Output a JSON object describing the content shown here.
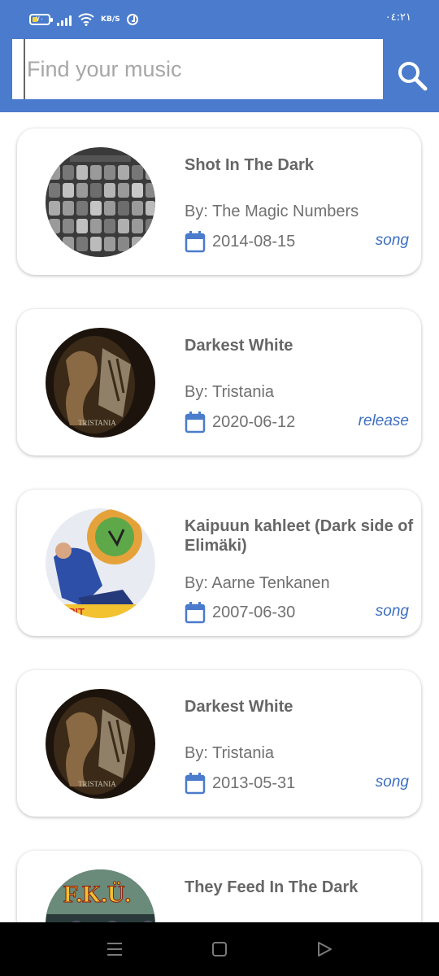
{
  "status_bar": {
    "battery_label": "٧٠",
    "net_speed": "KB/S",
    "time": "٠٤:٢١"
  },
  "search": {
    "placeholder": "Find your music",
    "value": ""
  },
  "results": [
    {
      "title": "Shot In The Dark",
      "artist": "By: The Magic Numbers",
      "date": "2014-08-15",
      "type": "song",
      "art": "magic-numbers-faces"
    },
    {
      "title": "Darkest White",
      "artist": "By: Tristania",
      "date": "2020-06-12",
      "type": "release",
      "art": "tristania"
    },
    {
      "title": "Kaipuun kahleet (Dark side of Elimäki)",
      "artist": "By: Aarne Tenkanen",
      "date": "2007-06-30",
      "type": "song",
      "art": "tenkanen"
    },
    {
      "title": "Darkest White",
      "artist": "By: Tristania",
      "date": "2013-05-31",
      "type": "song",
      "art": "tristania"
    },
    {
      "title": "They Feed In The Dark",
      "artist": "",
      "date": "",
      "type": "",
      "art": "fku"
    }
  ],
  "colors": {
    "header": "#4a7bcc",
    "accent": "#3d6fc1",
    "text_muted": "#707070"
  },
  "icons": [
    "search-icon",
    "calendar-icon",
    "menu-icon",
    "home-icon",
    "back-icon"
  ]
}
